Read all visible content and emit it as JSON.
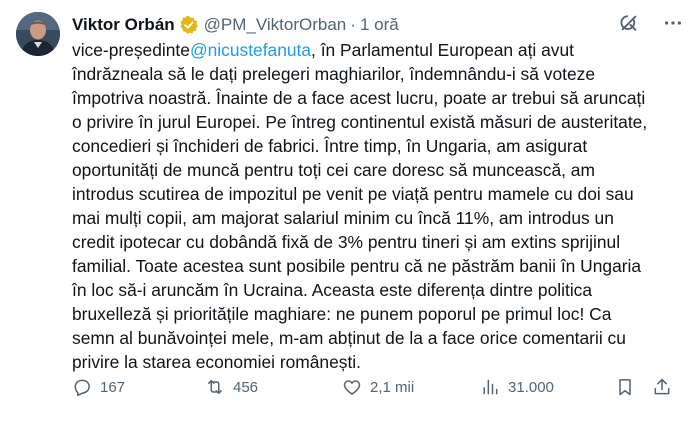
{
  "author": {
    "name": "Viktor Orbán",
    "handle": "@PM_ViktorOrban",
    "separator": "·",
    "time": "1 oră"
  },
  "icons": {
    "avatar": "avatar-photo",
    "verified": "verified-badge-icon",
    "grok": "grok-icon",
    "more": "more-options-icon",
    "reply": "reply-icon",
    "retweet": "retweet-icon",
    "like": "heart-icon",
    "views": "views-chart-icon",
    "bookmark": "bookmark-icon",
    "share": "share-icon"
  },
  "colors": {
    "accent": "#1d9bf0",
    "text": "#0f1419",
    "secondary": "#536471",
    "verified_gold": "#e2b719"
  },
  "tweet": {
    "prefix": "vice-președinte",
    "mention": "@nicustefanuta",
    "text": ", în Parlamentul European ați avut\nîndrăzneala să le dați prelegeri maghiarilor, îndemnându-i să voteze\nîmpotriva noastră. Înainte de a face acest lucru, poate ar trebui să aruncați\no privire în jurul Europei. Pe întreg continentul există măsuri de austeritate,\nconcedieri și închideri de fabrici. Între timp, în Ungaria, am asigurat\noportunități de muncă pentru toți cei care doresc să muncească, am\nintrodus scutirea de impozitul pe venit pe viață pentru mamele cu doi sau\nmai mulți copii, am majorat salariul minim cu încă 11%, am introdus un\ncredit ipotecar cu dobândă fixă de 3% pentru tineri și am extins sprijinul\nfamilial. Toate acestea sunt posibile pentru că ne păstrăm banii în Ungaria\nîn loc să-i aruncăm în Ucraina. Aceasta este diferența dintre politica\nbruxelleză și prioritățile maghiare: ne punem poporul pe primul loc! Ca\nsemn al bunăvoinței mele, m-am abținut de la a face orice comentarii cu\nprivire la starea economiei românești."
  },
  "actions": {
    "replies": "167",
    "retweets": "456",
    "likes": "2,1 mii",
    "views": "31.000"
  }
}
